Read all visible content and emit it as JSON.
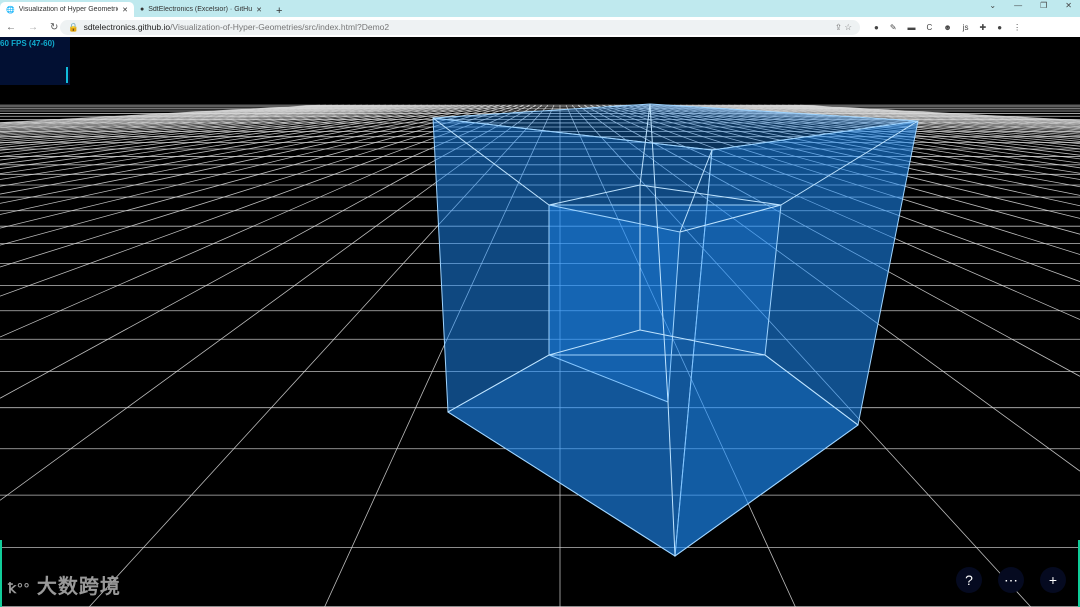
{
  "tabs": [
    {
      "title": "Visualization of Hyper Geometries",
      "active": true
    },
    {
      "title": "SdtElectronics (Excelsior) · GitHub",
      "active": false
    }
  ],
  "address": {
    "domain": "sdtelectronics.github.io",
    "path": "/Visualization-of-Hyper-Geometries/src/index.html?Demo2"
  },
  "fps": {
    "text": "60 FPS (47-60)"
  },
  "controls": {
    "help": "?",
    "more": "⋯",
    "add": "+"
  },
  "watermark": "大数跨境",
  "colors": {
    "cube": "#1e8fff",
    "grid": "#ffffff"
  }
}
